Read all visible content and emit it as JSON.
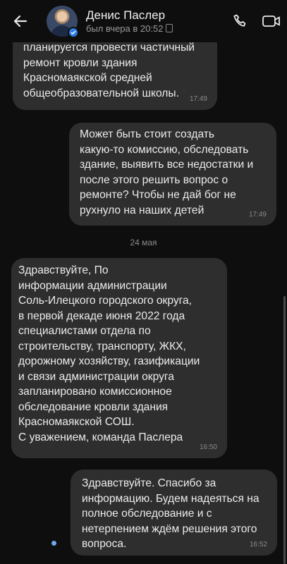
{
  "header": {
    "contact_name": "Денис Паслер",
    "last_seen": "был вчера в 20:52"
  },
  "messages": [
    {
      "direction": "incoming",
      "text": "планируется провести частичный\nремонт кровли здания\nКрасномаякской средней\nобщеобразовательной школы.",
      "time": "17:49"
    },
    {
      "direction": "outgoing",
      "text": "Может быть стоит создать\nкакую-то комиссию, обследовать\nздание, выявить все недостатки и\nпосле этого решить вопрос о\nремонте? Чтобы не дай бог не\nрухнуло на наших детей",
      "time": "17:49"
    },
    {
      "direction": "incoming",
      "text": "Здравствуйте,                   По\nинформации администрации\nСоль-Илецкого городского округа,\nв первой декаде июня 2022 года\nспециалистами отдела по\nстроительству, транспорту, ЖКХ,\nдорожному хозяйству, газификации\nи связи администрации округа\nзапланировано комиссионное\nобследование кровли здания\nКрасномаякской СОШ.\nС уважением, команда Паслера",
      "time": "16:50"
    },
    {
      "direction": "outgoing",
      "text": "Здравствуйте. Спасибо за\nинформацию. Будем надеяться на\nполное обследование и с\nнетерпением ждём решения этого\nвопроса.",
      "time": "16:52"
    }
  ],
  "date_separator": "24 мая",
  "colors": {
    "background": "#0e0e0e",
    "bubble": "#2e2e2e",
    "accent": "#2f7de1",
    "unread_dot": "#6ea8ea"
  },
  "icons": [
    "back-arrow-icon",
    "verified-badge-icon",
    "phone-icon",
    "video-call-icon",
    "device-icon"
  ]
}
